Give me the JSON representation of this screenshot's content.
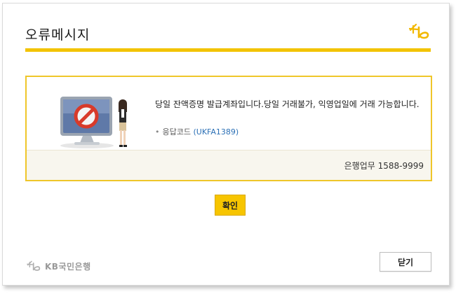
{
  "dialog": {
    "title": "오류메시지",
    "brand_icon": "kb-star-logo-icon",
    "accent_color": "#f2c300"
  },
  "message": {
    "text": "당일 잔액증명 발급계좌입니다.당일 거래불가, 익영업일에 거래 가능합니다.",
    "code_bullet": "•",
    "code_label": "응답코드",
    "code_value": "(UKFA1389)",
    "illustration": "error-monitor-with-agent-illustration"
  },
  "bank_info": {
    "text": "은행업무 1588-9999"
  },
  "buttons": {
    "confirm_label": "확인",
    "close_label": "닫기"
  },
  "footer": {
    "logo_text": "KB국민은행",
    "logo_icon": "kb-star-logo-icon"
  }
}
